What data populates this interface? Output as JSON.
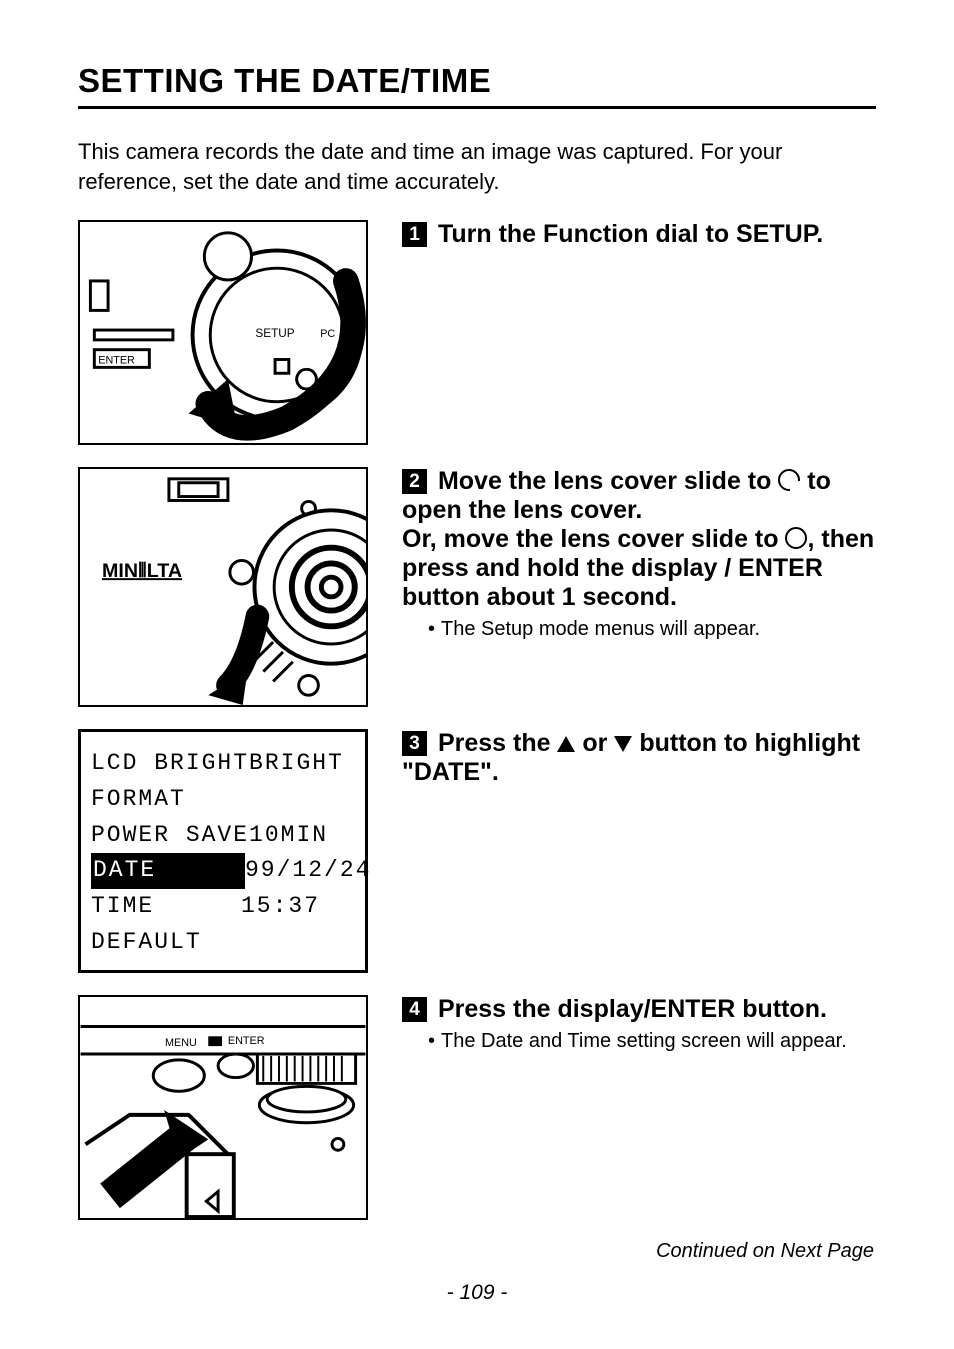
{
  "title": "SETTING THE DATE/TIME",
  "intro": "This camera records the date and time an image was captured. For your reference, set the date and time accurately.",
  "steps": {
    "s1": {
      "num": "1",
      "text": "Turn the Function dial to SETUP."
    },
    "s2": {
      "num": "2",
      "line1_a": "Move the lens cover slide to ",
      "line1_b": " to open the lens cover.",
      "line2_a": "Or, move the lens cover slide to ",
      "line2_b": ", then press and hold the display / ENTER button about 1 second.",
      "bullet": "The Setup mode menus will appear."
    },
    "s3": {
      "num": "3",
      "a": "Press the ",
      "b": " or ",
      "c": " button to highlight \"DATE\"."
    },
    "s4": {
      "num": "4",
      "text": "Press the display/ENTER button.",
      "bullet": "The Date and Time setting screen will appear."
    }
  },
  "lcd": {
    "r1": {
      "l": "LCD BRIGHT",
      "v": "BRIGHT"
    },
    "r2": {
      "l": "FORMAT",
      "v": ""
    },
    "r3": {
      "l": "POWER SAVE",
      "v": "10MIN"
    },
    "r4": {
      "l": "DATE",
      "v": "99/12/24"
    },
    "r5": {
      "l": "TIME",
      "v": "15:37"
    },
    "r6": {
      "l": "DEFAULT",
      "v": ""
    }
  },
  "figure1": {
    "setup_label": "SETUP",
    "pc_label": "PC",
    "enter_label": "ENTER"
  },
  "figure2": {
    "brand": "MIN⦀LTA"
  },
  "figure4": {
    "menu_label": "MENU",
    "enter_label": "ENTER"
  },
  "footer": {
    "cont": "Continued on Next Page",
    "page": "- 109 -"
  }
}
